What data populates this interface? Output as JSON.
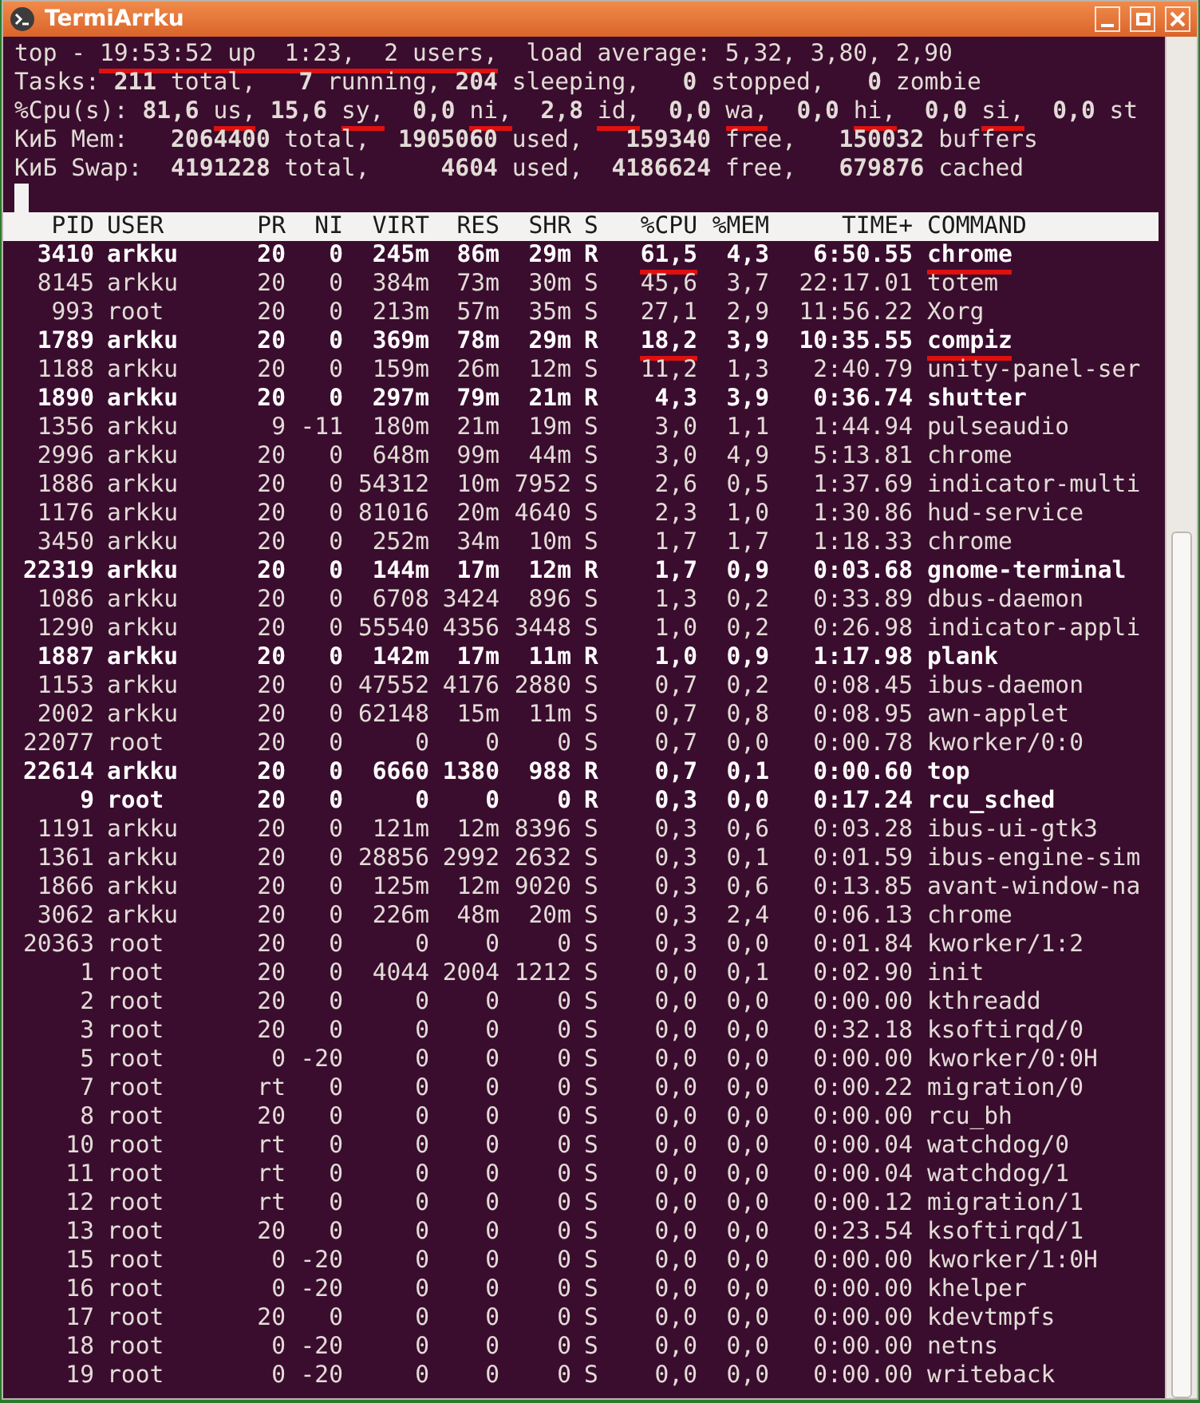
{
  "window": {
    "title": "TermiArrku"
  },
  "summary": [
    [
      {
        "text": "top - ",
        "underlined": false
      },
      {
        "text": "19:53:52 up  1:23,  2 users,",
        "underlined": true
      },
      {
        "text": "  load average: 5,32, 3,80, 2,90",
        "underlined": false
      }
    ],
    [
      {
        "text": "Tasks: **211** total,   **7** running, **204** sleeping,   **0** stopped,   **0** zombie",
        "underlined": false
      }
    ],
    [
      {
        "text": "%Cpu(s): **81,6** ",
        "underlined": false
      },
      {
        "text": "us,",
        "underlined": true
      },
      {
        "text": " **15,6** ",
        "underlined": false
      },
      {
        "text": "sy,",
        "underlined": true
      },
      {
        "text": "  **0,0** ",
        "underlined": false
      },
      {
        "text": "ni,",
        "underlined": true
      },
      {
        "text": "  **2,8** ",
        "underlined": false
      },
      {
        "text": "id,",
        "underlined": true
      },
      {
        "text": "  **0,0** ",
        "underlined": false
      },
      {
        "text": "wa,",
        "underlined": true
      },
      {
        "text": "  **0,0** ",
        "underlined": false
      },
      {
        "text": "hi,",
        "underlined": true
      },
      {
        "text": "  **0,0** ",
        "underlined": false
      },
      {
        "text": "si,",
        "underlined": true
      },
      {
        "text": "  **0,0** st",
        "underlined": false
      }
    ],
    [
      {
        "text": "КиБ Mem:   **2064400** total,  **1905060** used,   **159340** free,   **150032** buffers",
        "underlined": false
      }
    ],
    [
      {
        "text": "КиБ Swap:  **4191228** total,     **4604** used,  **4186624** free,   **679876** cached",
        "underlined": false
      }
    ]
  ],
  "table": {
    "columns": [
      "PID",
      "USER",
      "PR",
      "NI",
      "VIRT",
      "RES",
      "SHR",
      "S",
      "%CPU",
      "%MEM",
      "TIME+",
      "COMMAND"
    ],
    "rows": [
      {
        "cells": [
          "3410",
          "arkku",
          "20",
          "0",
          "245m",
          "86m",
          "29m",
          "R",
          "61,5",
          "4,3",
          "6:50.55",
          "chrome"
        ],
        "bold": true,
        "underlined": true
      },
      {
        "cells": [
          "8145",
          "arkku",
          "20",
          "0",
          "384m",
          "73m",
          "30m",
          "S",
          "45,6",
          "3,7",
          "22:17.01",
          "totem"
        ],
        "bold": false,
        "underlined": false
      },
      {
        "cells": [
          "993",
          "root",
          "20",
          "0",
          "213m",
          "57m",
          "35m",
          "S",
          "27,1",
          "2,9",
          "11:56.22",
          "Xorg"
        ],
        "bold": false,
        "underlined": false
      },
      {
        "cells": [
          "1789",
          "arkku",
          "20",
          "0",
          "369m",
          "78m",
          "29m",
          "R",
          "18,2",
          "3,9",
          "10:35.55",
          "compiz"
        ],
        "bold": true,
        "underlined": true
      },
      {
        "cells": [
          "1188",
          "arkku",
          "20",
          "0",
          "159m",
          "26m",
          "12m",
          "S",
          "11,2",
          "1,3",
          "2:40.79",
          "unity-panel-ser"
        ],
        "bold": false,
        "underlined": false
      },
      {
        "cells": [
          "1890",
          "arkku",
          "20",
          "0",
          "297m",
          "79m",
          "21m",
          "R",
          "4,3",
          "3,9",
          "0:36.74",
          "shutter"
        ],
        "bold": true,
        "underlined": false
      },
      {
        "cells": [
          "1356",
          "arkku",
          "9",
          "-11",
          "180m",
          "21m",
          "19m",
          "S",
          "3,0",
          "1,1",
          "1:44.94",
          "pulseaudio"
        ],
        "bold": false,
        "underlined": false
      },
      {
        "cells": [
          "2996",
          "arkku",
          "20",
          "0",
          "648m",
          "99m",
          "44m",
          "S",
          "3,0",
          "4,9",
          "5:13.81",
          "chrome"
        ],
        "bold": false,
        "underlined": false
      },
      {
        "cells": [
          "1886",
          "arkku",
          "20",
          "0",
          "54312",
          "10m",
          "7952",
          "S",
          "2,6",
          "0,5",
          "1:37.69",
          "indicator-multi"
        ],
        "bold": false,
        "underlined": false
      },
      {
        "cells": [
          "1176",
          "arkku",
          "20",
          "0",
          "81016",
          "20m",
          "4640",
          "S",
          "2,3",
          "1,0",
          "1:30.86",
          "hud-service"
        ],
        "bold": false,
        "underlined": false
      },
      {
        "cells": [
          "3450",
          "arkku",
          "20",
          "0",
          "252m",
          "34m",
          "10m",
          "S",
          "1,7",
          "1,7",
          "1:18.33",
          "chrome"
        ],
        "bold": false,
        "underlined": false
      },
      {
        "cells": [
          "22319",
          "arkku",
          "20",
          "0",
          "144m",
          "17m",
          "12m",
          "R",
          "1,7",
          "0,9",
          "0:03.68",
          "gnome-terminal"
        ],
        "bold": true,
        "underlined": false
      },
      {
        "cells": [
          "1086",
          "arkku",
          "20",
          "0",
          "6708",
          "3424",
          "896",
          "S",
          "1,3",
          "0,2",
          "0:33.89",
          "dbus-daemon"
        ],
        "bold": false,
        "underlined": false
      },
      {
        "cells": [
          "1290",
          "arkku",
          "20",
          "0",
          "55540",
          "4356",
          "3448",
          "S",
          "1,0",
          "0,2",
          "0:26.98",
          "indicator-appli"
        ],
        "bold": false,
        "underlined": false
      },
      {
        "cells": [
          "1887",
          "arkku",
          "20",
          "0",
          "142m",
          "17m",
          "11m",
          "R",
          "1,0",
          "0,9",
          "1:17.98",
          "plank"
        ],
        "bold": true,
        "underlined": false
      },
      {
        "cells": [
          "1153",
          "arkku",
          "20",
          "0",
          "47552",
          "4176",
          "2880",
          "S",
          "0,7",
          "0,2",
          "0:08.45",
          "ibus-daemon"
        ],
        "bold": false,
        "underlined": false
      },
      {
        "cells": [
          "2002",
          "arkku",
          "20",
          "0",
          "62148",
          "15m",
          "11m",
          "S",
          "0,7",
          "0,8",
          "0:08.95",
          "awn-applet"
        ],
        "bold": false,
        "underlined": false
      },
      {
        "cells": [
          "22077",
          "root",
          "20",
          "0",
          "0",
          "0",
          "0",
          "S",
          "0,7",
          "0,0",
          "0:00.78",
          "kworker/0:0"
        ],
        "bold": false,
        "underlined": false
      },
      {
        "cells": [
          "22614",
          "arkku",
          "20",
          "0",
          "6660",
          "1380",
          "988",
          "R",
          "0,7",
          "0,1",
          "0:00.60",
          "top"
        ],
        "bold": true,
        "underlined": false
      },
      {
        "cells": [
          "9",
          "root",
          "20",
          "0",
          "0",
          "0",
          "0",
          "R",
          "0,3",
          "0,0",
          "0:17.24",
          "rcu_sched"
        ],
        "bold": true,
        "underlined": false
      },
      {
        "cells": [
          "1191",
          "arkku",
          "20",
          "0",
          "121m",
          "12m",
          "8396",
          "S",
          "0,3",
          "0,6",
          "0:03.28",
          "ibus-ui-gtk3"
        ],
        "bold": false,
        "underlined": false
      },
      {
        "cells": [
          "1361",
          "arkku",
          "20",
          "0",
          "28856",
          "2992",
          "2632",
          "S",
          "0,3",
          "0,1",
          "0:01.59",
          "ibus-engine-sim"
        ],
        "bold": false,
        "underlined": false
      },
      {
        "cells": [
          "1866",
          "arkku",
          "20",
          "0",
          "125m",
          "12m",
          "9020",
          "S",
          "0,3",
          "0,6",
          "0:13.85",
          "avant-window-na"
        ],
        "bold": false,
        "underlined": false
      },
      {
        "cells": [
          "3062",
          "arkku",
          "20",
          "0",
          "226m",
          "48m",
          "20m",
          "S",
          "0,3",
          "2,4",
          "0:06.13",
          "chrome"
        ],
        "bold": false,
        "underlined": false
      },
      {
        "cells": [
          "20363",
          "root",
          "20",
          "0",
          "0",
          "0",
          "0",
          "S",
          "0,3",
          "0,0",
          "0:01.84",
          "kworker/1:2"
        ],
        "bold": false,
        "underlined": false
      },
      {
        "cells": [
          "1",
          "root",
          "20",
          "0",
          "4044",
          "2004",
          "1212",
          "S",
          "0,0",
          "0,1",
          "0:02.90",
          "init"
        ],
        "bold": false,
        "underlined": false
      },
      {
        "cells": [
          "2",
          "root",
          "20",
          "0",
          "0",
          "0",
          "0",
          "S",
          "0,0",
          "0,0",
          "0:00.00",
          "kthreadd"
        ],
        "bold": false,
        "underlined": false
      },
      {
        "cells": [
          "3",
          "root",
          "20",
          "0",
          "0",
          "0",
          "0",
          "S",
          "0,0",
          "0,0",
          "0:32.18",
          "ksoftirqd/0"
        ],
        "bold": false,
        "underlined": false
      },
      {
        "cells": [
          "5",
          "root",
          "0",
          "-20",
          "0",
          "0",
          "0",
          "S",
          "0,0",
          "0,0",
          "0:00.00",
          "kworker/0:0H"
        ],
        "bold": false,
        "underlined": false
      },
      {
        "cells": [
          "7",
          "root",
          "rt",
          "0",
          "0",
          "0",
          "0",
          "S",
          "0,0",
          "0,0",
          "0:00.22",
          "migration/0"
        ],
        "bold": false,
        "underlined": false
      },
      {
        "cells": [
          "8",
          "root",
          "20",
          "0",
          "0",
          "0",
          "0",
          "S",
          "0,0",
          "0,0",
          "0:00.00",
          "rcu_bh"
        ],
        "bold": false,
        "underlined": false
      },
      {
        "cells": [
          "10",
          "root",
          "rt",
          "0",
          "0",
          "0",
          "0",
          "S",
          "0,0",
          "0,0",
          "0:00.04",
          "watchdog/0"
        ],
        "bold": false,
        "underlined": false
      },
      {
        "cells": [
          "11",
          "root",
          "rt",
          "0",
          "0",
          "0",
          "0",
          "S",
          "0,0",
          "0,0",
          "0:00.04",
          "watchdog/1"
        ],
        "bold": false,
        "underlined": false
      },
      {
        "cells": [
          "12",
          "root",
          "rt",
          "0",
          "0",
          "0",
          "0",
          "S",
          "0,0",
          "0,0",
          "0:00.12",
          "migration/1"
        ],
        "bold": false,
        "underlined": false
      },
      {
        "cells": [
          "13",
          "root",
          "20",
          "0",
          "0",
          "0",
          "0",
          "S",
          "0,0",
          "0,0",
          "0:23.54",
          "ksoftirqd/1"
        ],
        "bold": false,
        "underlined": false
      },
      {
        "cells": [
          "15",
          "root",
          "0",
          "-20",
          "0",
          "0",
          "0",
          "S",
          "0,0",
          "0,0",
          "0:00.00",
          "kworker/1:0H"
        ],
        "bold": false,
        "underlined": false
      },
      {
        "cells": [
          "16",
          "root",
          "0",
          "-20",
          "0",
          "0",
          "0",
          "S",
          "0,0",
          "0,0",
          "0:00.00",
          "khelper"
        ],
        "bold": false,
        "underlined": false
      },
      {
        "cells": [
          "17",
          "root",
          "20",
          "0",
          "0",
          "0",
          "0",
          "S",
          "0,0",
          "0,0",
          "0:00.00",
          "kdevtmpfs"
        ],
        "bold": false,
        "underlined": false
      },
      {
        "cells": [
          "18",
          "root",
          "0",
          "-20",
          "0",
          "0",
          "0",
          "S",
          "0,0",
          "0,0",
          "0:00.00",
          "netns"
        ],
        "bold": false,
        "underlined": false
      },
      {
        "cells": [
          "19",
          "root",
          "0",
          "-20",
          "0",
          "0",
          "0",
          "S",
          "0,0",
          "0,0",
          "0:00.00",
          "writeback"
        ],
        "bold": false,
        "underlined": false
      }
    ]
  }
}
